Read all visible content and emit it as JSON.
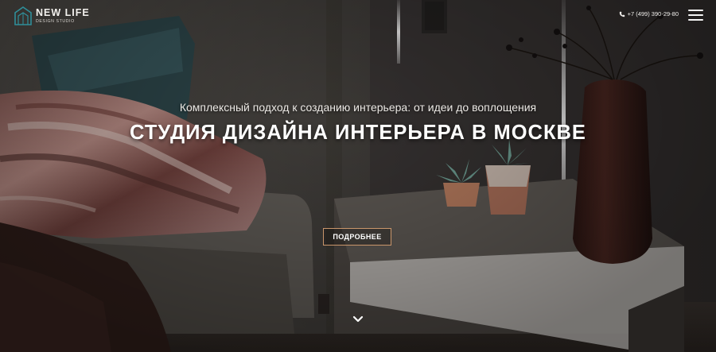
{
  "brand": {
    "name": "NEW LIFE",
    "tagline": "DESIGN STUDIO",
    "logo_icon": "house-outline-icon",
    "accent_color": "#2f8f9a"
  },
  "header": {
    "phone": "+7 (499) 390-29-80",
    "phone_icon": "phone-icon",
    "menu_icon": "hamburger-menu-icon"
  },
  "hero": {
    "subtitle": "Комплексный подход к созданию интерьера: от идеи до воплощения",
    "title": "СТУДИЯ ДИЗАЙНА ИНТЕРЬЕРА В МОСКВЕ",
    "cta_label": "ПОДРОБНЕЕ",
    "cta_border_color": "#c9966b",
    "scroll_icon": "chevron-down-icon"
  }
}
